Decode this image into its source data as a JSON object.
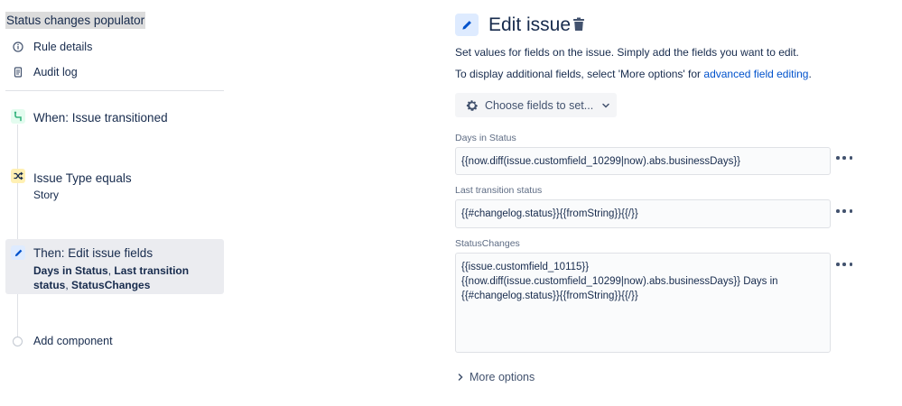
{
  "sidebar": {
    "rule_title": "Status changes populator",
    "links": [
      {
        "label": "Rule details",
        "icon": "info-icon"
      },
      {
        "label": "Audit log",
        "icon": "audit-log-icon"
      }
    ],
    "components": [
      {
        "title": "When: Issue transitioned",
        "icon": "trigger-icon",
        "color": "#36b37e"
      },
      {
        "title": "Issue Type equals",
        "subtitle": "Story",
        "icon": "condition-icon",
        "color": "#ffc400"
      },
      {
        "title": "Then: Edit issue fields",
        "icon": "edit-icon",
        "color": "#0052cc",
        "fields": [
          "Days in Status",
          "Last transition status",
          "StatusChanges"
        ],
        "separator": ","
      }
    ],
    "add_component_label": "Add component"
  },
  "editor": {
    "title": "Edit issue",
    "description_1": "Set values for fields on the issue. Simply add the fields you want to edit.",
    "description_2_prefix": "To display additional fields, select 'More options' for ",
    "description_2_link": "advanced field editing",
    "description_2_suffix": ".",
    "choose_fields_label": "Choose fields to set...",
    "fields": [
      {
        "label": "Days in Status",
        "value": "{{now.diff(issue.customfield_10299|now).abs.businessDays}}"
      },
      {
        "label": "Last transition status",
        "value": "{{#changelog.status}}{{fromString}}{{/}}"
      },
      {
        "label": "StatusChanges",
        "value": "{{issue.customfield_10115}}\n{{now.diff(issue.customfield_10299|now).abs.businessDays}} Days in\n{{#changelog.status}}{{fromString}}{{/}}"
      }
    ],
    "more_options_label": "More options"
  }
}
